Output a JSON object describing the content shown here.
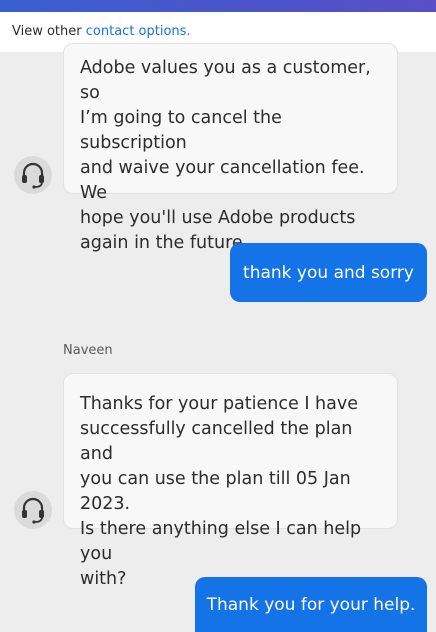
{
  "header": {
    "prefix": "View other",
    "link": "contact options."
  },
  "messages": [
    {
      "from": "agent",
      "lines": [
        "Adobe values you as a customer, so",
        "I’m going to cancel the subscription",
        "and waive your cancellation fee. We",
        "hope you'll use Adobe products",
        "again in the future."
      ]
    },
    {
      "from": "user",
      "text": "thank you and sorry"
    },
    {
      "from": "agent",
      "sender": "Naveen",
      "lines": [
        "Thanks for your patience I have",
        "successfully cancelled the plan and",
        "you can use the plan till 05 Jan 2023.",
        "Is there anything else I can help you",
        "with?"
      ]
    },
    {
      "from": "user",
      "text": "Thank you for your help."
    }
  ],
  "colors": {
    "accent": "#1473e6",
    "background": "#ededed"
  },
  "icons": {
    "agent_avatar": "headset-icon"
  }
}
